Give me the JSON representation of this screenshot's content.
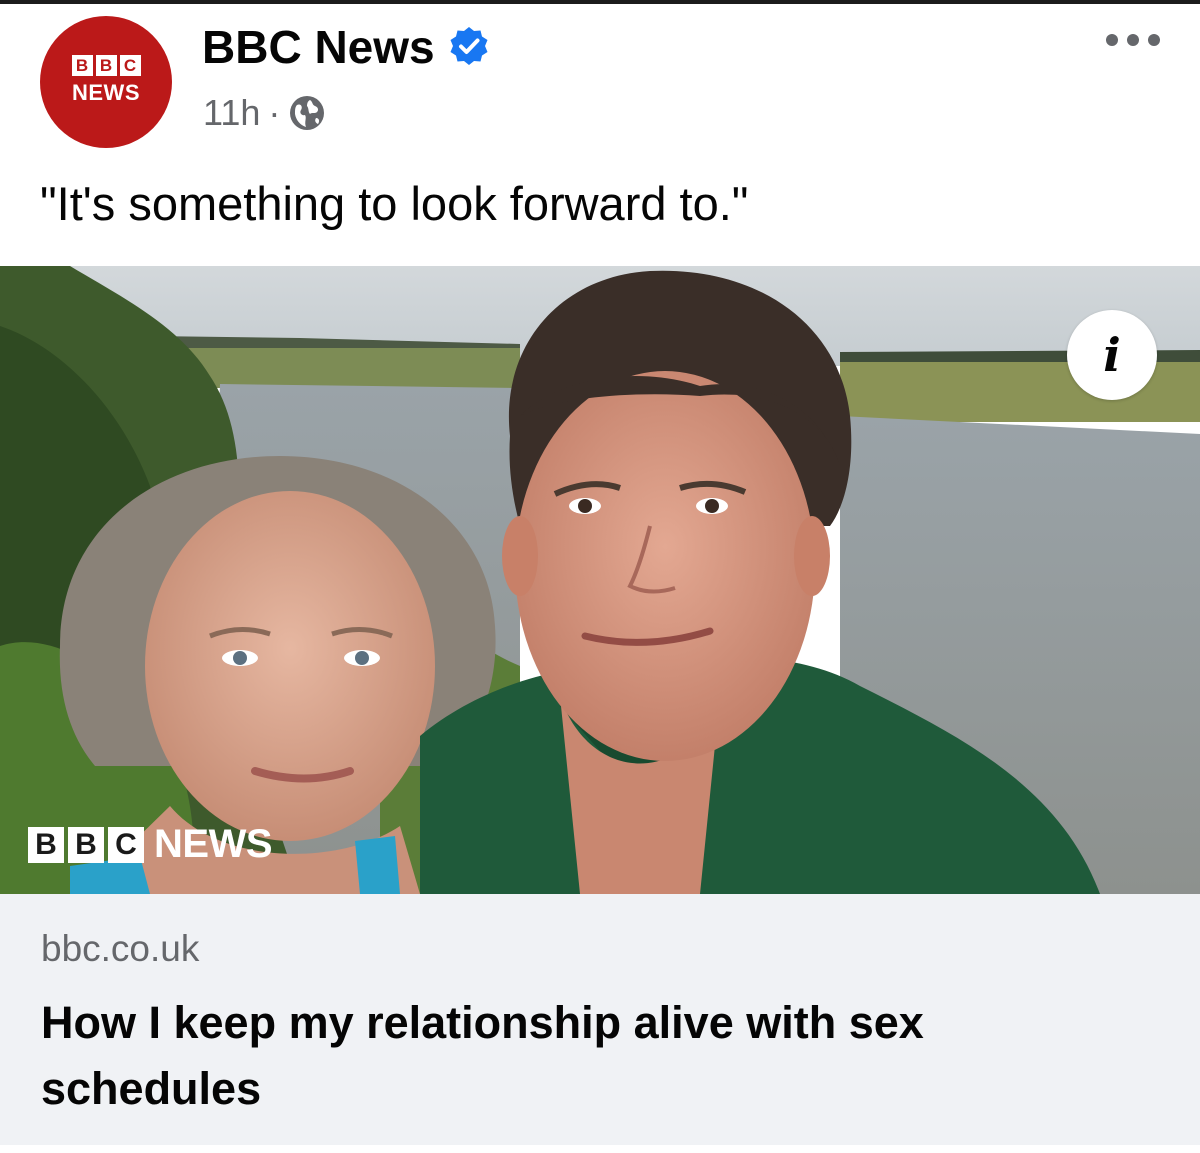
{
  "post": {
    "page_name": "BBC News",
    "verified": true,
    "timestamp": "11h",
    "separator": "·",
    "caption": "\"It's something to look forward to.\""
  },
  "avatar": {
    "blocks": [
      "B",
      "B",
      "C"
    ],
    "news_label": "NEWS"
  },
  "image": {
    "info_glyph": "i",
    "watermark_blocks": [
      "B",
      "B",
      "C"
    ],
    "watermark_news": "NEWS"
  },
  "link_preview": {
    "domain": "bbc.co.uk",
    "title": "How I keep my relationship alive with sex schedules"
  },
  "icons": {
    "verified": "verified-badge-icon",
    "audience": "globe-icon",
    "more": "more-options-icon",
    "info": "info-icon"
  },
  "colors": {
    "bbc_red": "#bb1919",
    "verified_blue": "#1877f2",
    "secondary_text": "#65676b",
    "link_card_bg": "#f0f2f5"
  }
}
